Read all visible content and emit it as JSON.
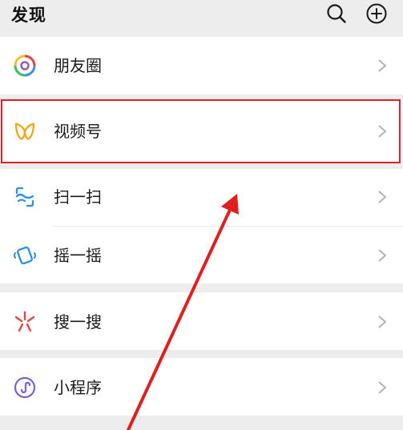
{
  "header": {
    "title": "发现",
    "icons": [
      "search-icon",
      "add-icon"
    ]
  },
  "menu": [
    {
      "id": "moments",
      "label": "朋友圈",
      "icon": "moments-icon"
    },
    {
      "id": "channels",
      "label": "视频号",
      "icon": "channels-icon"
    },
    {
      "id": "scan",
      "label": "扫一扫",
      "icon": "scan-icon"
    },
    {
      "id": "shake",
      "label": "摇一摇",
      "icon": "shake-icon"
    },
    {
      "id": "search",
      "label": "搜一搜",
      "icon": "search-feature-icon"
    },
    {
      "id": "miniprogram",
      "label": "小程序",
      "icon": "mini-program-icon"
    }
  ],
  "colors": {
    "background": "#ededed",
    "card": "#ffffff",
    "annotation": "#e02020",
    "text": "#1a1a1a"
  }
}
